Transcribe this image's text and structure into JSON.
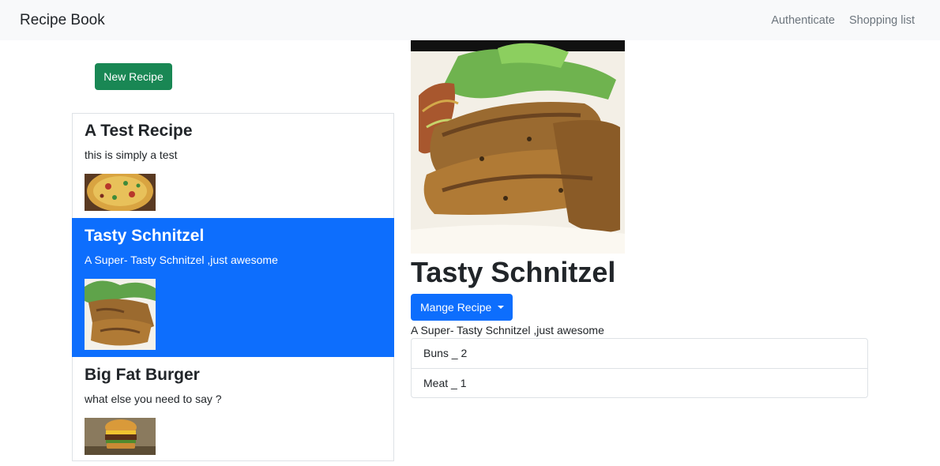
{
  "navbar": {
    "brand": "Recipe Book",
    "links": [
      "Authenticate",
      "Shopping list"
    ]
  },
  "new_recipe_label": "New Recipe",
  "recipes": [
    {
      "name": "A Test Recipe",
      "description": "this is simply a test",
      "active": false
    },
    {
      "name": "Tasty Schnitzel",
      "description": "A Super- Tasty Schnitzel ,just awesome",
      "active": true
    },
    {
      "name": "Big Fat Burger",
      "description": "what else you need to say ?",
      "active": false
    }
  ],
  "detail": {
    "name": "Tasty Schnitzel",
    "manage_label": "Mange Recipe",
    "description": "A Super- Tasty Schnitzel ,just awesome",
    "ingredients": [
      "Buns _ 2",
      "Meat _ 1"
    ]
  },
  "colors": {
    "navbar_bg": "#f8f9fa",
    "success": "#198754",
    "primary": "#0d6efd"
  }
}
